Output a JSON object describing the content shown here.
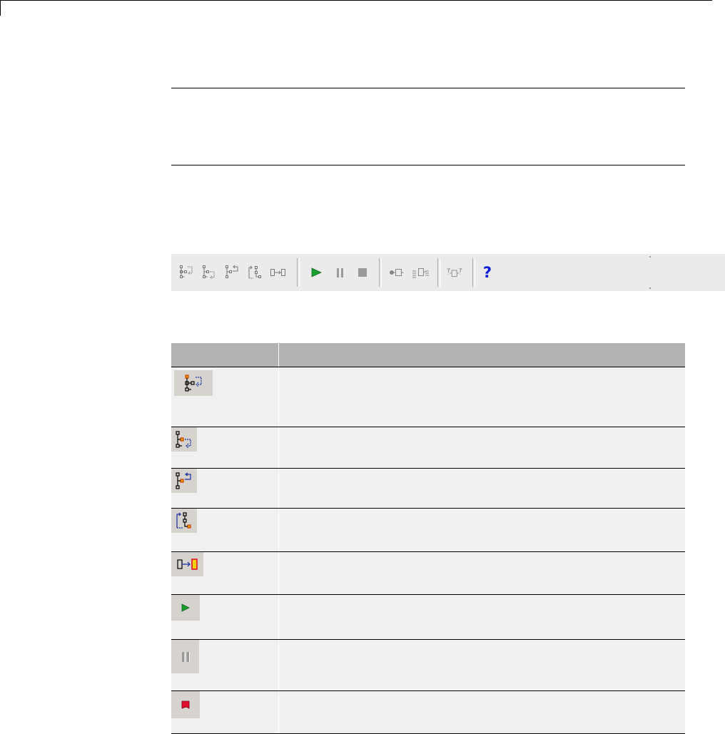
{
  "toolbar": {
    "buttons": [
      {
        "icon": "step-in-icon",
        "group": "step"
      },
      {
        "icon": "step-over-icon",
        "group": "step"
      },
      {
        "icon": "step-out-icon",
        "group": "step"
      },
      {
        "icon": "step-to-next-icon",
        "group": "step"
      },
      {
        "icon": "go-to-next-block-icon",
        "group": "step"
      },
      {
        "icon": "start-continue-icon",
        "group": "run"
      },
      {
        "icon": "pause-icon",
        "group": "run"
      },
      {
        "icon": "stop-icon",
        "group": "run"
      },
      {
        "icon": "breakpoint-icon",
        "group": "breakpoints"
      },
      {
        "icon": "breakpoints-list-icon",
        "group": "breakpoints"
      },
      {
        "icon": "watch-data-value-icon",
        "group": "display"
      },
      {
        "icon": "help-icon",
        "group": "help",
        "glyph": "?"
      }
    ]
  },
  "table": {
    "headers": [
      "",
      ""
    ],
    "rows": [
      {
        "icon": "step-in-icon",
        "description": ""
      },
      {
        "icon": "step-over-icon",
        "description": ""
      },
      {
        "icon": "step-out-icon",
        "description": ""
      },
      {
        "icon": "step-to-next-icon",
        "description": ""
      },
      {
        "icon": "go-to-next-block-icon",
        "description": ""
      },
      {
        "icon": "start-continue-icon",
        "description": ""
      },
      {
        "icon": "pause-icon",
        "description": ""
      },
      {
        "icon": "stop-icon",
        "description": ""
      }
    ]
  },
  "colors": {
    "header_bg": "#b2b2b2",
    "row_bg": "#f0f0f0",
    "toolbar_bg": "#ebebeb",
    "run_green": "#1a9e2c",
    "stop_red": "#e0102a",
    "help_blue": "#0b1fd6",
    "highlight_orange": "#f5a000"
  }
}
